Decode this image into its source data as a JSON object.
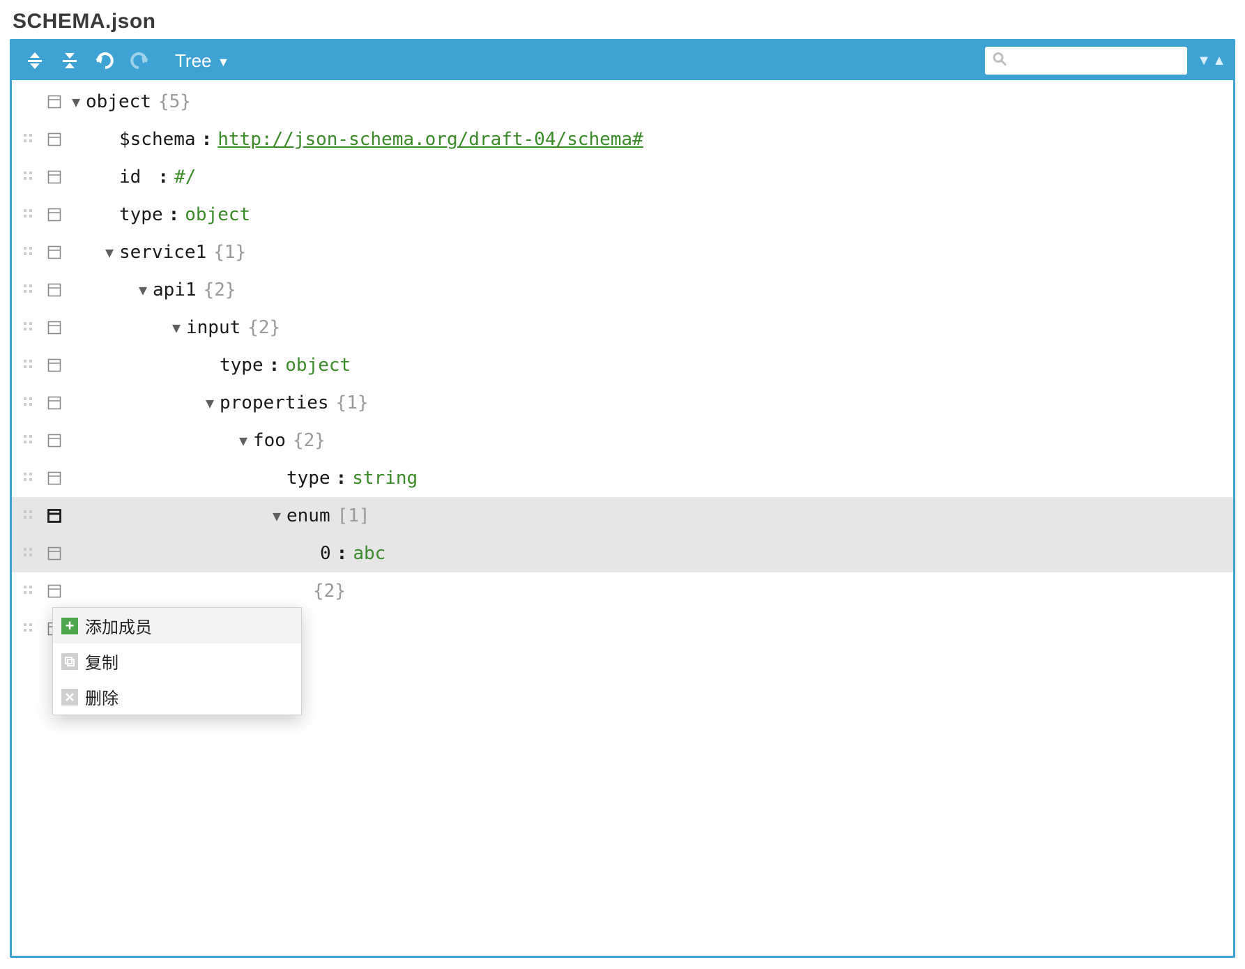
{
  "file_title": "SCHEMA.json",
  "toolbar": {
    "mode_label": "Tree",
    "search_placeholder": ""
  },
  "rows": [
    {
      "drag": false,
      "indent": 0,
      "caret": true,
      "key": "object",
      "meta": "{5}",
      "highlight": false
    },
    {
      "drag": true,
      "indent": 1,
      "caret": false,
      "key": "$schema",
      "sep": ":",
      "link": "http://json-schema.org/draft-04/schema#",
      "highlight": false
    },
    {
      "drag": true,
      "indent": 1,
      "caret": false,
      "key": "id",
      "pad_key": true,
      "sep": ":",
      "val": "#/",
      "highlight": false
    },
    {
      "drag": true,
      "indent": 1,
      "caret": false,
      "key": "type",
      "sep": ":",
      "val": "object",
      "highlight": false
    },
    {
      "drag": true,
      "indent": 1,
      "caret": true,
      "key": "service1",
      "meta": "{1}",
      "highlight": false
    },
    {
      "drag": true,
      "indent": 2,
      "caret": true,
      "key": "api1",
      "meta": "{2}",
      "highlight": false
    },
    {
      "drag": true,
      "indent": 3,
      "caret": true,
      "key": "input",
      "meta": "{2}",
      "highlight": false
    },
    {
      "drag": true,
      "indent": 4,
      "caret": false,
      "key": "type",
      "sep": ":",
      "val": "object",
      "highlight": false
    },
    {
      "drag": true,
      "indent": 4,
      "caret": true,
      "key": "properties",
      "meta": "{1}",
      "highlight": false
    },
    {
      "drag": true,
      "indent": 5,
      "caret": true,
      "key": "foo",
      "meta": "{2}",
      "highlight": false
    },
    {
      "drag": true,
      "indent": 6,
      "caret": false,
      "key": "type",
      "sep": ":",
      "val": "string",
      "highlight": false
    },
    {
      "drag": true,
      "indent": 6,
      "caret": true,
      "key": "enum",
      "meta": "[1]",
      "highlight": true,
      "bold_menu": true
    },
    {
      "drag": true,
      "indent": 7,
      "caret": false,
      "key": "0",
      "sep": ":",
      "val": "abc",
      "highlight": true
    },
    {
      "drag": true,
      "indent": 3,
      "caret": false,
      "key": "",
      "peek_meta": "{2}",
      "highlight": false
    },
    {
      "drag": true,
      "indent": 2,
      "caret": false,
      "key": "",
      "highlight": false
    }
  ],
  "context_menu": {
    "items": [
      {
        "icon": "plus",
        "label": "添加成员",
        "hover": true
      },
      {
        "icon": "copy",
        "label": "复制",
        "hover": false
      },
      {
        "icon": "close",
        "label": "删除",
        "hover": false
      }
    ]
  }
}
